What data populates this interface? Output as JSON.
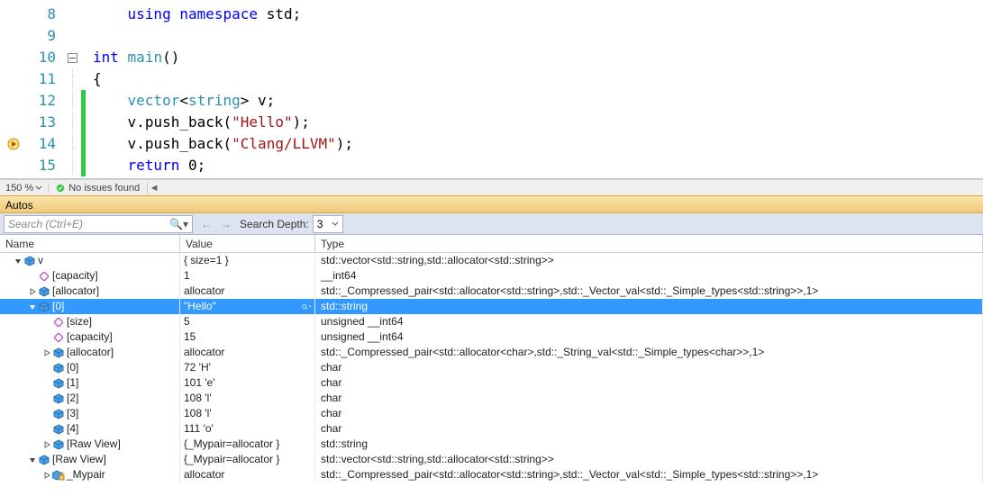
{
  "editor": {
    "lines": [
      {
        "num": "8",
        "fold": "",
        "change": false,
        "bp": "",
        "tokens": [
          [
            "    ",
            ""
          ],
          [
            "using",
            "kw"
          ],
          [
            " ",
            ""
          ],
          [
            "namespace",
            "kw"
          ],
          [
            " ",
            ""
          ],
          [
            "std",
            ""
          ],
          [
            ";",
            "punct"
          ]
        ]
      },
      {
        "num": "9",
        "fold": "",
        "change": false,
        "bp": "",
        "tokens": []
      },
      {
        "num": "10",
        "fold": "⊟",
        "change": false,
        "bp": "",
        "tokens": [
          [
            "int",
            "kw"
          ],
          [
            " ",
            ""
          ],
          [
            "main",
            "typ"
          ],
          [
            "()",
            ""
          ]
        ]
      },
      {
        "num": "11",
        "fold": "|",
        "change": false,
        "bp": "",
        "tokens": [
          [
            "{",
            "punct"
          ]
        ]
      },
      {
        "num": "12",
        "fold": "|",
        "change": true,
        "bp": "",
        "tokens": [
          [
            "    ",
            ""
          ],
          [
            "vector",
            "typ"
          ],
          [
            "<",
            "punct"
          ],
          [
            "string",
            "typ"
          ],
          [
            "> ",
            "punct"
          ],
          [
            "v",
            ""
          ],
          [
            ";",
            "punct"
          ]
        ]
      },
      {
        "num": "13",
        "fold": "|",
        "change": true,
        "bp": "",
        "tokens": [
          [
            "    ",
            ""
          ],
          [
            "v",
            ""
          ],
          [
            ".",
            "punct"
          ],
          [
            "push_back",
            ""
          ],
          [
            "(",
            "punct"
          ],
          [
            "\"Hello\"",
            "str"
          ],
          [
            ")",
            "punct"
          ],
          [
            ";",
            "punct"
          ]
        ]
      },
      {
        "num": "14",
        "fold": "|",
        "change": true,
        "bp": "arrow",
        "tokens": [
          [
            "    ",
            ""
          ],
          [
            "v",
            ""
          ],
          [
            ".",
            "punct"
          ],
          [
            "push_back",
            ""
          ],
          [
            "(",
            "punct"
          ],
          [
            "\"Clang/LLVM\"",
            "str"
          ],
          [
            ")",
            "punct"
          ],
          [
            ";",
            "punct"
          ]
        ]
      },
      {
        "num": "15",
        "fold": "|",
        "change": true,
        "bp": "",
        "tokens": [
          [
            "    ",
            ""
          ],
          [
            "return",
            "kw"
          ],
          [
            " 0",
            ""
          ],
          [
            ";",
            "punct"
          ]
        ]
      }
    ],
    "status": {
      "zoom": "150 %",
      "issues": "No issues found"
    }
  },
  "panel": {
    "title": "Autos"
  },
  "toolbar": {
    "search_placeholder": "Search (Ctrl+E)",
    "depth_label": "Search Depth:",
    "depth_value": "3"
  },
  "grid": {
    "headers": {
      "name": "Name",
      "value": "Value",
      "type": "Type"
    },
    "rows": [
      {
        "indent": 0,
        "expander": "open",
        "icon": "cube-blue",
        "name": "v",
        "value": "{ size=1 }",
        "type": "std::vector<std::string,std::allocator<std::string>>",
        "selected": false,
        "magnify": false
      },
      {
        "indent": 1,
        "expander": "",
        "icon": "diamond",
        "name": "[capacity]",
        "value": "1",
        "type": "__int64",
        "selected": false,
        "magnify": false
      },
      {
        "indent": 1,
        "expander": "closed",
        "icon": "cube-blue",
        "name": "[allocator]",
        "value": "allocator",
        "type": "std::_Compressed_pair<std::allocator<std::string>,std::_Vector_val<std::_Simple_types<std::string>>,1>",
        "selected": false,
        "magnify": false
      },
      {
        "indent": 1,
        "expander": "open",
        "icon": "cube-blue",
        "name": "[0]",
        "value": "\"Hello\"",
        "type": "std::string",
        "selected": true,
        "magnify": true
      },
      {
        "indent": 2,
        "expander": "",
        "icon": "diamond",
        "name": "[size]",
        "value": "5",
        "type": "unsigned __int64",
        "selected": false,
        "magnify": false
      },
      {
        "indent": 2,
        "expander": "",
        "icon": "diamond",
        "name": "[capacity]",
        "value": "15",
        "type": "unsigned __int64",
        "selected": false,
        "magnify": false
      },
      {
        "indent": 2,
        "expander": "closed",
        "icon": "cube-blue",
        "name": "[allocator]",
        "value": "allocator",
        "type": "std::_Compressed_pair<std::allocator<char>,std::_String_val<std::_Simple_types<char>>,1>",
        "selected": false,
        "magnify": false
      },
      {
        "indent": 2,
        "expander": "",
        "icon": "cube-blue",
        "name": "[0]",
        "value": "72 'H'",
        "type": "char",
        "selected": false,
        "magnify": false
      },
      {
        "indent": 2,
        "expander": "",
        "icon": "cube-blue",
        "name": "[1]",
        "value": "101 'e'",
        "type": "char",
        "selected": false,
        "magnify": false
      },
      {
        "indent": 2,
        "expander": "",
        "icon": "cube-blue",
        "name": "[2]",
        "value": "108 'l'",
        "type": "char",
        "selected": false,
        "magnify": false
      },
      {
        "indent": 2,
        "expander": "",
        "icon": "cube-blue",
        "name": "[3]",
        "value": "108 'l'",
        "type": "char",
        "selected": false,
        "magnify": false
      },
      {
        "indent": 2,
        "expander": "",
        "icon": "cube-blue",
        "name": "[4]",
        "value": "111 'o'",
        "type": "char",
        "selected": false,
        "magnify": false
      },
      {
        "indent": 2,
        "expander": "closed",
        "icon": "cube-blue",
        "name": "[Raw View]",
        "value": "{_Mypair=allocator }",
        "type": "std::string",
        "selected": false,
        "magnify": false
      },
      {
        "indent": 1,
        "expander": "open",
        "icon": "cube-blue",
        "name": "[Raw View]",
        "value": "{_Mypair=allocator }",
        "type": "std::vector<std::string,std::allocator<std::string>>",
        "selected": false,
        "magnify": false
      },
      {
        "indent": 2,
        "expander": "closed",
        "icon": "cube-lock",
        "name": "_Mypair",
        "value": "allocator",
        "type": "std::_Compressed_pair<std::allocator<std::string>,std::_Vector_val<std::_Simple_types<std::string>>,1>",
        "selected": false,
        "magnify": false
      }
    ]
  }
}
